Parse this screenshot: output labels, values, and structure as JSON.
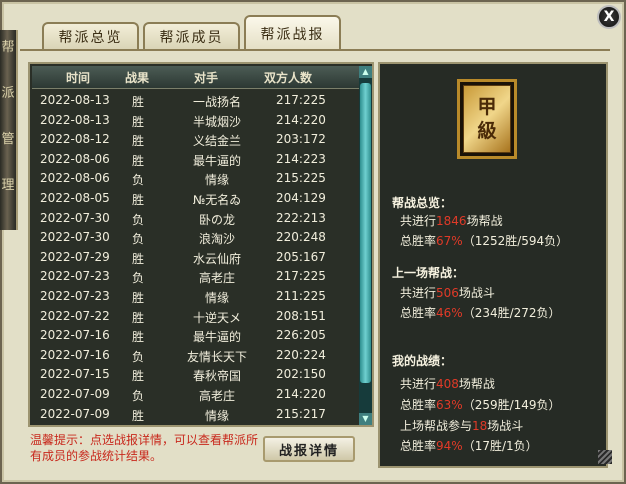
{
  "side_scroll_chars": [
    "帮",
    "派",
    "管",
    "理"
  ],
  "tabs": [
    {
      "label": "帮派总览"
    },
    {
      "label": "帮派成员"
    },
    {
      "label": "帮派战报"
    }
  ],
  "close_label": "X",
  "table": {
    "headers": [
      "时间",
      "战果",
      "对手",
      "双方人数"
    ],
    "rows": [
      {
        "date": "2022-08-13",
        "result": "胜",
        "opponent": "一战扬名",
        "counts": "217:225"
      },
      {
        "date": "2022-08-13",
        "result": "胜",
        "opponent": "半城烟沙",
        "counts": "214:220"
      },
      {
        "date": "2022-08-12",
        "result": "胜",
        "opponent": "义结金兰",
        "counts": "203:172"
      },
      {
        "date": "2022-08-06",
        "result": "胜",
        "opponent": "最牛逼的",
        "counts": "214:223"
      },
      {
        "date": "2022-08-06",
        "result": "负",
        "opponent": "情缘",
        "counts": "215:225"
      },
      {
        "date": "2022-08-05",
        "result": "胜",
        "opponent": "№无名ゐ",
        "counts": "204:129"
      },
      {
        "date": "2022-07-30",
        "result": "负",
        "opponent": "卧の龙",
        "counts": "222:213"
      },
      {
        "date": "2022-07-30",
        "result": "负",
        "opponent": "浪淘沙",
        "counts": "220:248"
      },
      {
        "date": "2022-07-29",
        "result": "胜",
        "opponent": "水云仙府",
        "counts": "205:167"
      },
      {
        "date": "2022-07-23",
        "result": "负",
        "opponent": "高老庄",
        "counts": "217:225"
      },
      {
        "date": "2022-07-23",
        "result": "胜",
        "opponent": "情缘",
        "counts": "211:225"
      },
      {
        "date": "2022-07-22",
        "result": "胜",
        "opponent": "十逆天メ",
        "counts": "208:151"
      },
      {
        "date": "2022-07-16",
        "result": "胜",
        "opponent": "最牛逼的",
        "counts": "226:205"
      },
      {
        "date": "2022-07-16",
        "result": "负",
        "opponent": "友情长天下",
        "counts": "220:224"
      },
      {
        "date": "2022-07-15",
        "result": "胜",
        "opponent": "春秋帝国",
        "counts": "202:150"
      },
      {
        "date": "2022-07-09",
        "result": "负",
        "opponent": "高老庄",
        "counts": "214:220"
      },
      {
        "date": "2022-07-09",
        "result": "胜",
        "opponent": "情缘",
        "counts": "215:217"
      }
    ]
  },
  "hint": "温馨提示：点选战报详情，可以查看帮派所有成员的参战统计结果。",
  "detail_button": "战报详情",
  "badge": {
    "line1": "甲",
    "line2": "級"
  },
  "summary": {
    "overview_title": "帮战总览：",
    "overview_total_prefix": "共进行",
    "overview_total_value": "1846",
    "overview_total_suffix": "场帮战",
    "overview_rate_prefix": "总胜率",
    "overview_rate_value": "67%",
    "overview_rate_detail": "（1252胜/594负）",
    "last_title": "上一场帮战：",
    "last_total_prefix": "共进行",
    "last_total_value": "506",
    "last_total_suffix": "场战斗",
    "last_rate_prefix": "总胜率",
    "last_rate_value": "46%",
    "last_rate_detail": "（234胜/272负）",
    "mine_title": "我的战绩：",
    "mine_total_prefix": "共进行",
    "mine_total_value": "408",
    "mine_total_suffix": "场帮战",
    "mine_rate_prefix": "总胜率",
    "mine_rate_value": "63%",
    "mine_rate_detail": "（259胜/149负）",
    "mine_last_prefix": "上场帮战参与",
    "mine_last_value": "18",
    "mine_last_suffix": "场战斗",
    "mine_last_rate_prefix": "总胜率",
    "mine_last_rate_value": "94%",
    "mine_last_rate_detail": "（17胜/1负）"
  },
  "colors": {
    "accent_red": "#e03a28",
    "panel_dark": "#2a2f27",
    "frame": "#e2dfc7"
  }
}
